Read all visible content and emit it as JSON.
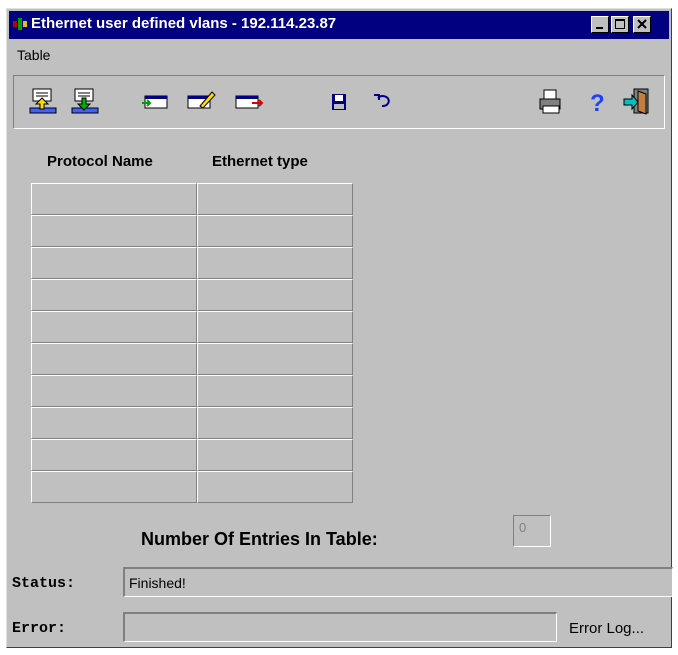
{
  "window": {
    "title": "Ethernet user defined vlans - 192.114.23.87",
    "controls": [
      "minimize",
      "maximize",
      "close"
    ]
  },
  "menu": {
    "items": [
      "Table"
    ]
  },
  "toolbar": {
    "icons": [
      "upload-icon",
      "download-icon",
      "insert-row-icon",
      "edit-row-icon",
      "delete-row-icon",
      "save-icon",
      "undo-icon",
      "print-icon",
      "help-icon",
      "exit-icon"
    ]
  },
  "table": {
    "columns": [
      "Protocol Name",
      "Ethernet type"
    ],
    "rows": [
      [
        "",
        ""
      ],
      [
        "",
        ""
      ],
      [
        "",
        ""
      ],
      [
        "",
        ""
      ],
      [
        "",
        ""
      ],
      [
        "",
        ""
      ],
      [
        "",
        ""
      ],
      [
        "",
        ""
      ],
      [
        "",
        ""
      ],
      [
        "",
        ""
      ]
    ]
  },
  "entries": {
    "label": "Number Of Entries In Table:",
    "value": "0"
  },
  "status": {
    "label": "Status:",
    "value": "Finished!"
  },
  "error": {
    "label": "Error:",
    "value": "",
    "log_button": "Error Log..."
  }
}
